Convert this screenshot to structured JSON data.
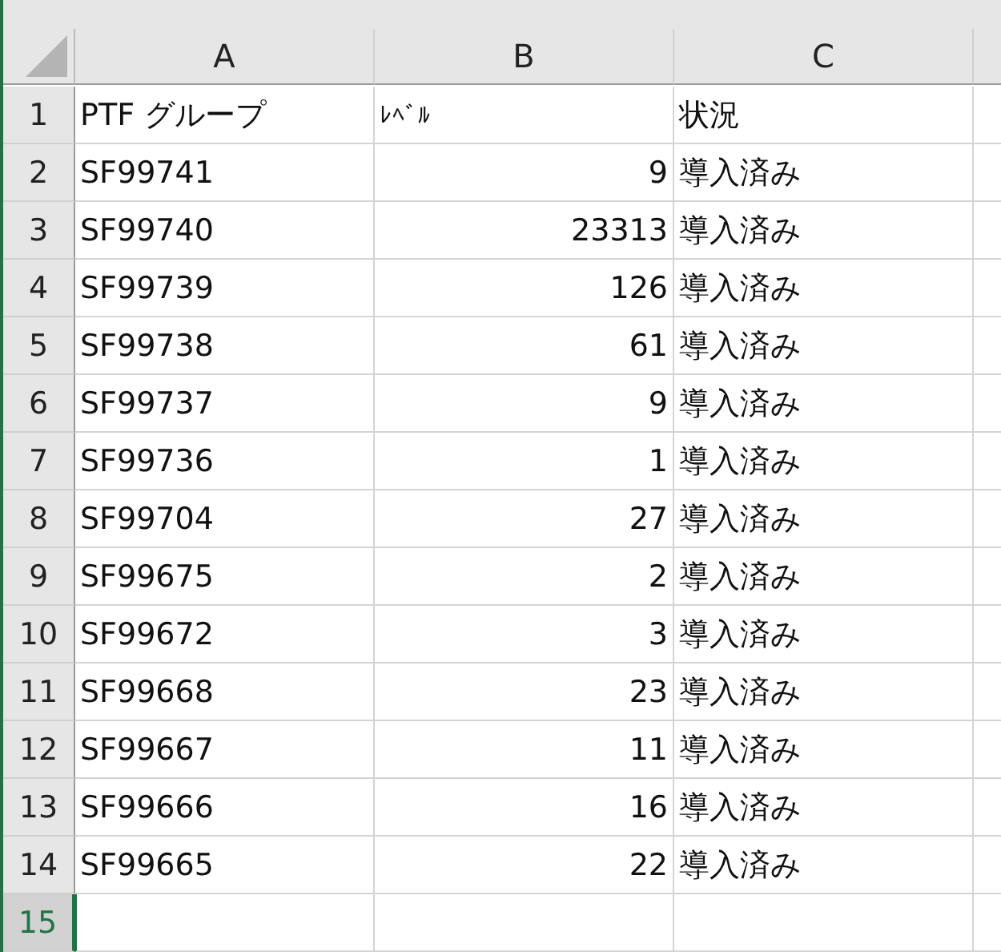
{
  "columns": [
    "A",
    "B",
    "C"
  ],
  "rows": [
    {
      "number": "1",
      "selected": false,
      "cells": [
        "PTF  グループ",
        "ﾚﾍﾞﾙ",
        "状況"
      ]
    },
    {
      "number": "2",
      "selected": false,
      "cells": [
        "SF99741",
        "9",
        "導入済み"
      ]
    },
    {
      "number": "3",
      "selected": false,
      "cells": [
        "SF99740",
        "23313",
        "導入済み"
      ]
    },
    {
      "number": "4",
      "selected": false,
      "cells": [
        "SF99739",
        "126",
        "導入済み"
      ]
    },
    {
      "number": "5",
      "selected": false,
      "cells": [
        "SF99738",
        "61",
        "導入済み"
      ]
    },
    {
      "number": "6",
      "selected": false,
      "cells": [
        "SF99737",
        "9",
        "導入済み"
      ]
    },
    {
      "number": "7",
      "selected": false,
      "cells": [
        "SF99736",
        "1",
        "導入済み"
      ]
    },
    {
      "number": "8",
      "selected": false,
      "cells": [
        "SF99704",
        "27",
        "導入済み"
      ]
    },
    {
      "number": "9",
      "selected": false,
      "cells": [
        "SF99675",
        "2",
        "導入済み"
      ]
    },
    {
      "number": "10",
      "selected": false,
      "cells": [
        "SF99672",
        "3",
        "導入済み"
      ]
    },
    {
      "number": "11",
      "selected": false,
      "cells": [
        "SF99668",
        "23",
        "導入済み"
      ]
    },
    {
      "number": "12",
      "selected": false,
      "cells": [
        "SF99667",
        "11",
        "導入済み"
      ]
    },
    {
      "number": "13",
      "selected": false,
      "cells": [
        "SF99666",
        "16",
        "導入済み"
      ]
    },
    {
      "number": "14",
      "selected": false,
      "cells": [
        "SF99665",
        "22",
        "導入済み"
      ]
    },
    {
      "number": "15",
      "selected": true,
      "cells": [
        "",
        "",
        ""
      ]
    }
  ]
}
